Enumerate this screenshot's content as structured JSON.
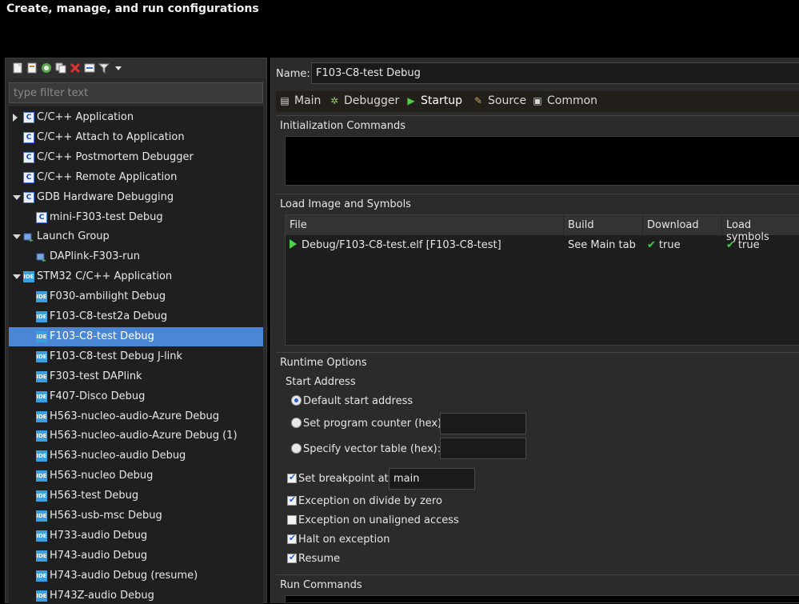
{
  "header": {
    "title": "Create, manage, and run configurations"
  },
  "toolbar": {
    "icons": [
      "new-launch-config-icon",
      "new-prototype-icon",
      "export-icon",
      "duplicate-icon",
      "delete-icon",
      "collapse-all-icon",
      "filter-icon",
      "view-menu-icon"
    ]
  },
  "filter": {
    "placeholder": "type filter text",
    "value": ""
  },
  "tree": {
    "items": [
      {
        "label": "C/C++ Application",
        "icon": "c",
        "twisty": "collapsed",
        "level": 0
      },
      {
        "label": "C/C++ Attach to Application",
        "icon": "c",
        "twisty": "none",
        "level": 0
      },
      {
        "label": "C/C++ Postmortem Debugger",
        "icon": "c",
        "twisty": "none",
        "level": 0
      },
      {
        "label": "C/C++ Remote Application",
        "icon": "c",
        "twisty": "none",
        "level": 0
      },
      {
        "label": "GDB Hardware Debugging",
        "icon": "c",
        "twisty": "expanded",
        "level": 0
      },
      {
        "label": "mini-F303-test Debug",
        "icon": "c",
        "twisty": "none",
        "level": 1
      },
      {
        "label": "Launch Group",
        "icon": "lg",
        "twisty": "expanded",
        "level": 0
      },
      {
        "label": "DAPlink-F303-run",
        "icon": "lg",
        "twisty": "none",
        "level": 1
      },
      {
        "label": "STM32 C/C++ Application",
        "icon": "ide",
        "twisty": "expanded",
        "level": 0
      },
      {
        "label": "F030-ambilight Debug",
        "icon": "ide",
        "twisty": "none",
        "level": 1
      },
      {
        "label": "F103-C8-test2a Debug",
        "icon": "ide",
        "twisty": "none",
        "level": 1
      },
      {
        "label": "F103-C8-test Debug",
        "icon": "ide",
        "twisty": "none",
        "level": 1,
        "selected": true
      },
      {
        "label": "F103-C8-test Debug J-link",
        "icon": "ide",
        "twisty": "none",
        "level": 1
      },
      {
        "label": "F303-test DAPlink",
        "icon": "ide",
        "twisty": "none",
        "level": 1
      },
      {
        "label": "F407-Disco Debug",
        "icon": "ide",
        "twisty": "none",
        "level": 1
      },
      {
        "label": "H563-nucleo-audio-Azure Debug",
        "icon": "ide",
        "twisty": "none",
        "level": 1
      },
      {
        "label": "H563-nucleo-audio-Azure Debug (1)",
        "icon": "ide",
        "twisty": "none",
        "level": 1
      },
      {
        "label": "H563-nucleo-audio Debug",
        "icon": "ide",
        "twisty": "none",
        "level": 1
      },
      {
        "label": "H563-nucleo Debug",
        "icon": "ide",
        "twisty": "none",
        "level": 1
      },
      {
        "label": "H563-test Debug",
        "icon": "ide",
        "twisty": "none",
        "level": 1
      },
      {
        "label": "H563-usb-msc Debug",
        "icon": "ide",
        "twisty": "none",
        "level": 1
      },
      {
        "label": "H733-audio Debug",
        "icon": "ide",
        "twisty": "none",
        "level": 1
      },
      {
        "label": "H743-audio Debug",
        "icon": "ide",
        "twisty": "none",
        "level": 1
      },
      {
        "label": "H743-audio Debug (resume)",
        "icon": "ide",
        "twisty": "none",
        "level": 1
      },
      {
        "label": "H743Z-audio Debug",
        "icon": "ide",
        "twisty": "none",
        "level": 1
      }
    ]
  },
  "icon_text": {
    "c": "C",
    "ide": "IDE"
  },
  "name": {
    "label": "Name:",
    "value": "F103-C8-test Debug"
  },
  "tabs": [
    {
      "label": "Main",
      "icon": "main-tab-icon",
      "glyph": "▤"
    },
    {
      "label": "Debugger",
      "icon": "debugger-tab-icon",
      "glyph": "✲"
    },
    {
      "label": "Startup",
      "icon": "startup-tab-icon",
      "glyph": "▶",
      "active": true
    },
    {
      "label": "Source",
      "icon": "source-tab-icon",
      "glyph": "✎"
    },
    {
      "label": "Common",
      "icon": "common-tab-icon",
      "glyph": "▣"
    }
  ],
  "init": {
    "title": "Initialization Commands",
    "value": ""
  },
  "load": {
    "title": "Load Image and Symbols",
    "columns": [
      "File",
      "Build",
      "Download",
      "Load symbols"
    ],
    "rows": [
      {
        "file": "Debug/F103-C8-test.elf [F103-C8-test]",
        "build": "See Main tab",
        "download": "true",
        "symbols": "true"
      }
    ]
  },
  "runtime": {
    "title": "Runtime Options",
    "start_address_label": "Start Address",
    "radio_default": "Default start address",
    "radio_pc": "Set program counter (hex):",
    "radio_vector": "Specify vector table (hex):",
    "pc_value": "",
    "vector_value": "",
    "breakpoint_label": "Set breakpoint at:",
    "breakpoint_value": "main",
    "exc_div_zero": "Exception on divide by zero",
    "exc_unaligned": "Exception on unaligned access",
    "halt_on_exception": "Halt on exception",
    "resume": "Resume"
  },
  "run": {
    "title": "Run Commands"
  },
  "colors": {
    "selection": "#4a86d4",
    "accent_green": "#3cd23c",
    "background": "#2b2b2b"
  }
}
